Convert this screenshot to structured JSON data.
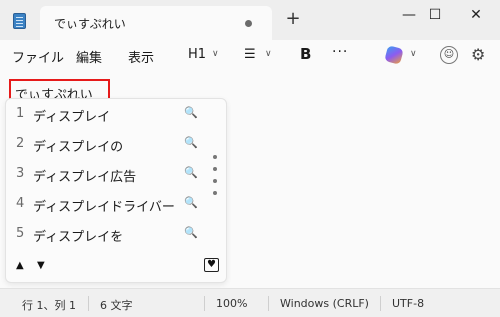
{
  "window": {
    "tab_title": "でぃすぷれい",
    "new_tab": "+",
    "minimize": "—",
    "maximize": "☐",
    "close": "✕"
  },
  "menu": {
    "file": "ファイル",
    "edit": "編集",
    "view": "表示",
    "heading": "H1",
    "heading_caret": "∨",
    "list": "☰",
    "list_caret": "∨",
    "bold": "B",
    "more": "···",
    "copilot_caret": "∨",
    "avatar": "☺",
    "settings": "⚙"
  },
  "editor": {
    "composing_text": "でぃすぷれい"
  },
  "candidates": {
    "items": [
      {
        "num": "1",
        "text": "ディスプレイ",
        "search": "🔍"
      },
      {
        "num": "2",
        "text": "ディスプレイの",
        "search": "🔍"
      },
      {
        "num": "3",
        "text": "ディスプレイ広告",
        "search": "🔍"
      },
      {
        "num": "4",
        "text": "ディスプレイドライバー",
        "search": "🔍"
      },
      {
        "num": "5",
        "text": "ディスプレイを",
        "search": "🔍"
      }
    ],
    "prev": "▲",
    "next": "▼",
    "favorite": "♥"
  },
  "status": {
    "position": "行 1、列 1",
    "chars": "6 文字",
    "zoom": "100%",
    "line_ending": "Windows (CRLF)",
    "encoding": "UTF-8"
  },
  "colors": {
    "highlight_border": "#e61a1a",
    "background": "#fafafa"
  }
}
